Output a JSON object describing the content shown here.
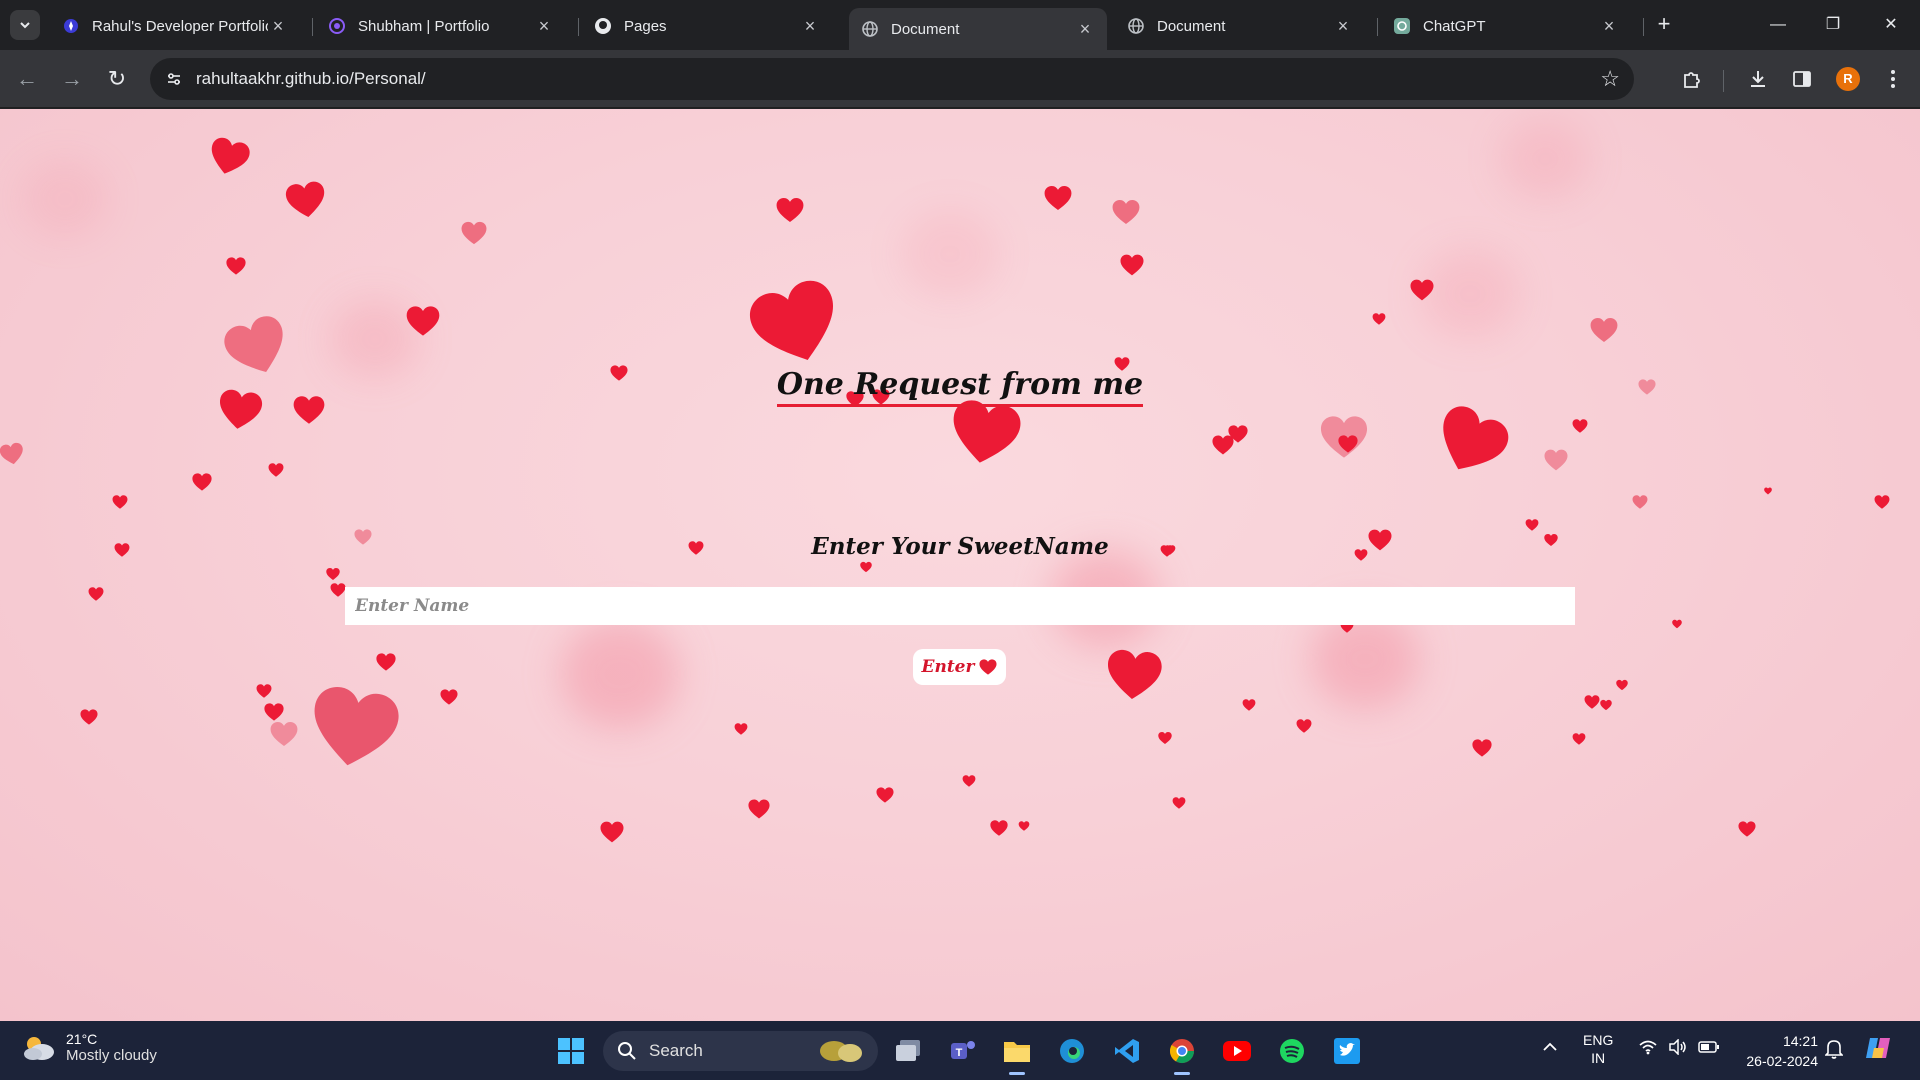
{
  "browser": {
    "tabs": [
      {
        "title": "Rahul's Developer Portfolio",
        "icon": "portfolio-favicon"
      },
      {
        "title": "Shubham | Portfolio",
        "icon": "portfolio-favicon"
      },
      {
        "title": "Pages",
        "icon": "github-icon"
      },
      {
        "title": "Document",
        "icon": "globe-icon",
        "active": true
      },
      {
        "title": "Document",
        "icon": "globe-icon"
      },
      {
        "title": "ChatGPT",
        "icon": "chatgpt-icon"
      }
    ],
    "url": "rahultaakhr.github.io/Personal/",
    "profile_initial": "R"
  },
  "page": {
    "title": "One Request from me",
    "prompt_label": "Enter Your SweetName",
    "name_placeholder": "Enter Name",
    "name_value": "",
    "enter_label": "Enter",
    "accent_color": "#e61e33",
    "background_color": "#f8d0d7"
  },
  "taskbar": {
    "weather_temp": "21°C",
    "weather_desc": "Mostly cloudy",
    "search_label": "Search",
    "lang_1": "ENG",
    "lang_2": "IN",
    "time": "14:21",
    "date": "26-02-2024"
  }
}
